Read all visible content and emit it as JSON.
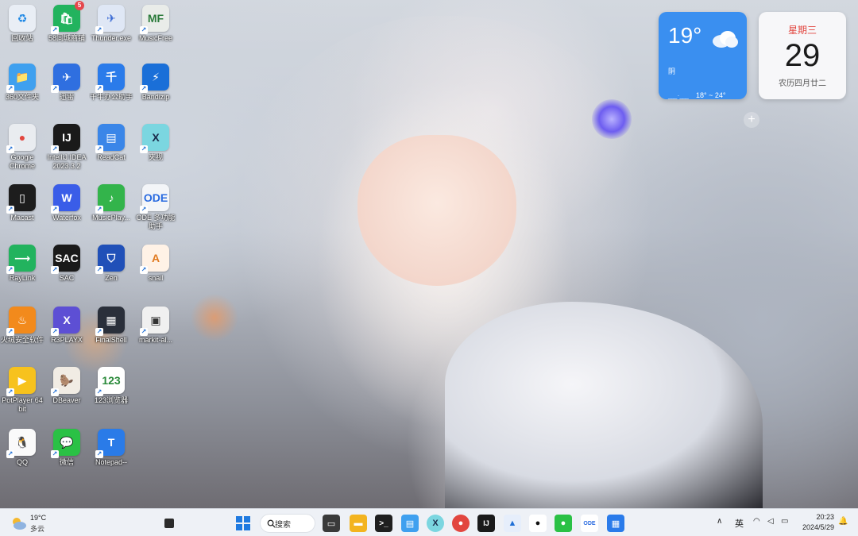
{
  "desktop": {
    "icons": [
      {
        "label": "回收站",
        "glyph": "♻",
        "color": "#e9eef5",
        "fg": "#1e88e5"
      },
      {
        "label": "58同城商铺",
        "glyph": "🛍",
        "color": "#22b35e",
        "badge": "5"
      },
      {
        "label": "Thunder.exe",
        "glyph": "✈",
        "color": "#dfe7f5",
        "fg": "#3869d4"
      },
      {
        "label": "MusicFree",
        "glyph": "MF",
        "color": "#e9ece9",
        "fg": "#2a7a3a"
      },
      {
        "label": "360文件夹",
        "glyph": "📁",
        "color": "#3fa0ef"
      },
      {
        "label": "迅雷",
        "glyph": "✈",
        "color": "#2f6fe0"
      },
      {
        "label": "千牛办公助手",
        "glyph": "千",
        "color": "#2a7bea"
      },
      {
        "label": "Bandizip",
        "glyph": "⚡",
        "color": "#1a6fd8"
      },
      {
        "label": "Google Chrome",
        "glyph": "●",
        "color": "#e9ecf0",
        "fg": "#e2463f"
      },
      {
        "label": "IntelliJ IDEA 2023.3.2",
        "glyph": "IJ",
        "color": "#1a1a1a"
      },
      {
        "label": "ReadCat",
        "glyph": "▤",
        "color": "#3a86e8"
      },
      {
        "label": "夹视",
        "glyph": "X",
        "color": "#7bd6e0",
        "fg": "#1a2a4a"
      },
      {
        "label": "Macast",
        "glyph": "▯",
        "color": "#1d1d1d"
      },
      {
        "label": "Waterfox",
        "glyph": "W",
        "color": "#3a5de8"
      },
      {
        "label": "MusicPlay...",
        "glyph": "♪",
        "color": "#33b44b"
      },
      {
        "label": "ODE 多功能助手",
        "glyph": "ODE",
        "color": "#f3f5f8",
        "fg": "#2a6be0"
      },
      {
        "label": "RayLink",
        "glyph": "⟶",
        "color": "#22b35e"
      },
      {
        "label": "SAC",
        "glyph": "SAC",
        "color": "#1a1a1a"
      },
      {
        "label": "Zen",
        "glyph": "⛉",
        "color": "#2050b8"
      },
      {
        "label": "snail",
        "glyph": "A",
        "color": "#fff2e6",
        "fg": "#e07a20"
      },
      {
        "label": "火绒安全软件",
        "glyph": "♨",
        "color": "#f28a1c"
      },
      {
        "label": "R3PLAYX",
        "glyph": "X",
        "color": "#5d4fd4"
      },
      {
        "label": "FinalShell",
        "glyph": "▦",
        "color": "#2a2f3a"
      },
      {
        "label": "markit-al...",
        "glyph": "▣",
        "color": "#f0f0f0",
        "fg": "#333"
      },
      {
        "label": "PotPlayer 64 bit",
        "glyph": "▶",
        "color": "#f7c21d"
      },
      {
        "label": "DBeaver",
        "glyph": "🦫",
        "color": "#f1ece4",
        "fg": "#6b4a2a"
      },
      {
        "label": "123浏览器",
        "glyph": "123",
        "color": "#ffffff",
        "fg": "#2a8a3a"
      },
      {
        "label": "QQ",
        "glyph": "🐧",
        "color": "#fafafa",
        "fg": "#111"
      },
      {
        "label": "微信",
        "glyph": "💬",
        "color": "#2ac145"
      },
      {
        "label": "Notepad--",
        "glyph": "T",
        "color": "#2a7be8"
      }
    ]
  },
  "weather_widget": {
    "temp": "19°",
    "condition": "阴",
    "location": "___ · ___",
    "range": "18° ~ 24°"
  },
  "calendar_widget": {
    "weekday": "星期三",
    "day": "29",
    "lunar": "农历四月廿二"
  },
  "add_widget": "+",
  "taskbar": {
    "weather_temp": "19°C",
    "weather_text": "多云",
    "search_label": "搜索",
    "lang": "英",
    "time": "20:23",
    "date": "2024/5/29"
  }
}
